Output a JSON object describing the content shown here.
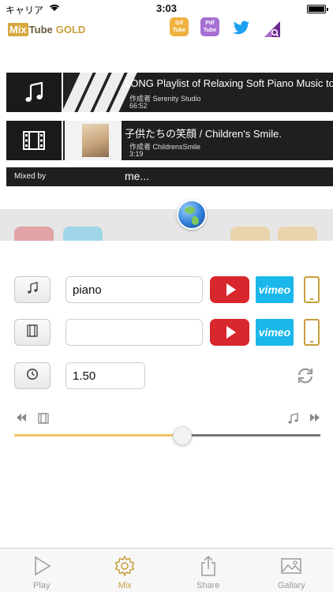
{
  "status_bar": {
    "carrier": "キャリア",
    "time": "3:03"
  },
  "header": {
    "logo_mix": "Mix",
    "logo_tube": "Tube",
    "logo_gold": "GOLD",
    "icons": [
      {
        "name": "gif-tube-icon",
        "line1": "Gif",
        "line2": "Tube"
      },
      {
        "name": "pdf-tube-icon",
        "line1": "Pdf",
        "line2": "Tube"
      },
      {
        "name": "twitter-icon"
      },
      {
        "name": "q-app-icon"
      }
    ]
  },
  "playlist": {
    "music": {
      "title": "LONG Playlist of Relaxing Soft Piano Music to",
      "author": "作成者 Serenity Studio",
      "duration": "66:52"
    },
    "video": {
      "title": "子供たちの笑顔 / Children's Smile.",
      "author": "作成者 ChildrensSmile",
      "duration": "3:19"
    },
    "mixed_by_label": "Mixed by",
    "mixed_by_value": "me..."
  },
  "form": {
    "music_query": "piano",
    "video_query": "",
    "interval": "1.50",
    "vimeo_label": "vimeo"
  },
  "slider": {
    "value_fraction": 0.55
  },
  "tabs": [
    {
      "label": "Play",
      "icon": "play-icon",
      "active": false
    },
    {
      "label": "Mix",
      "icon": "gear-icon",
      "active": true
    },
    {
      "label": "Share",
      "icon": "share-icon",
      "active": false
    },
    {
      "label": "Gallary",
      "icon": "gallery-icon",
      "active": false
    }
  ],
  "colors": {
    "accent": "#c79f3d",
    "youtube": "#d9272e",
    "vimeo": "#1ab7ea"
  }
}
